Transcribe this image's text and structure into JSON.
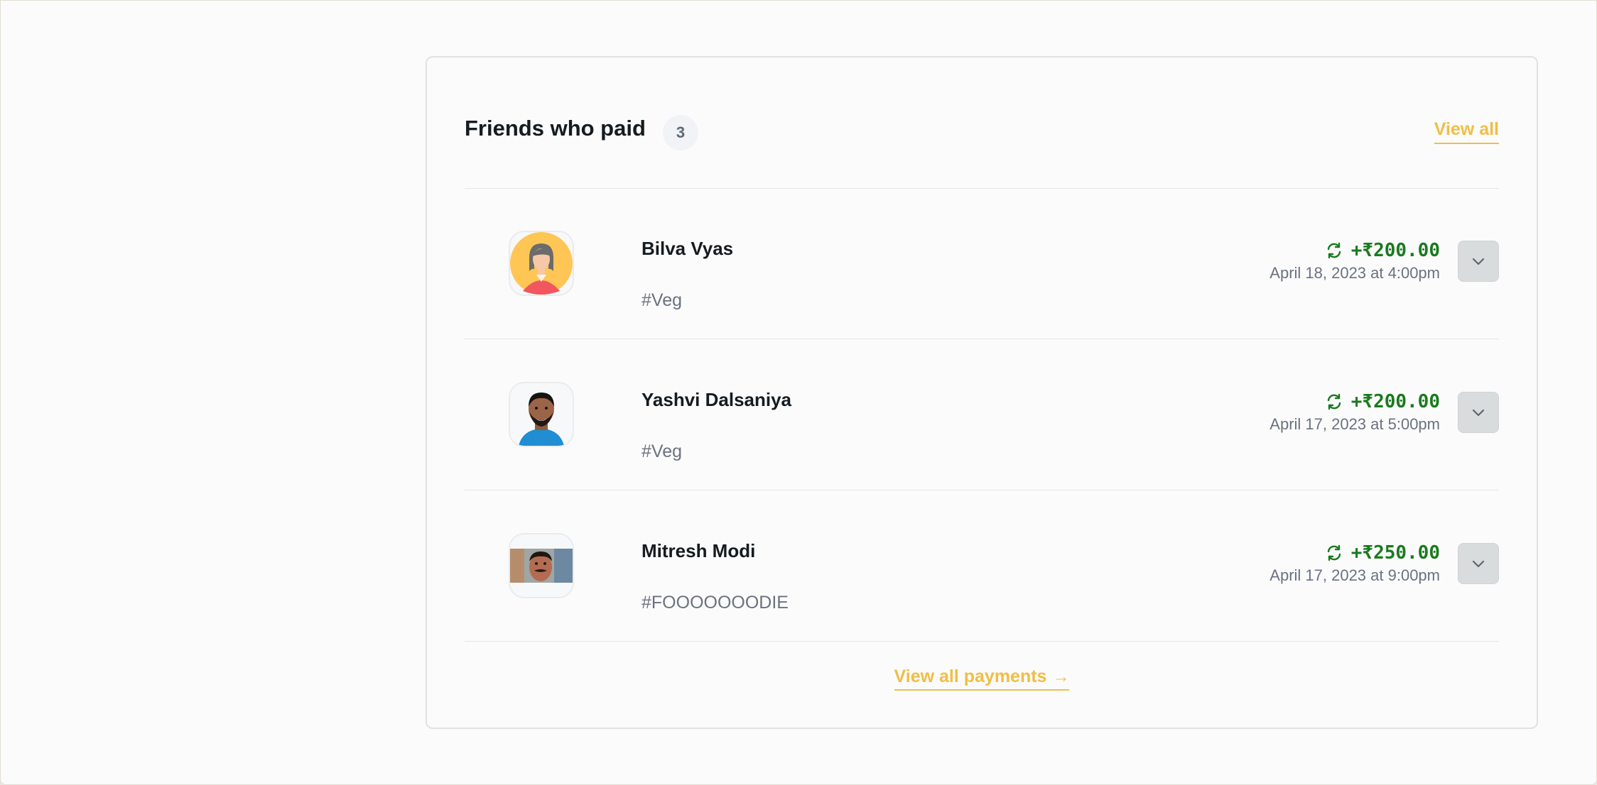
{
  "friends_paid": {
    "title": "Friends who paid",
    "count": "3",
    "view_all_label": "View all",
    "footer_link_label": "View all payments",
    "payments": [
      {
        "name": "Bilva Vyas",
        "tag": "#Veg",
        "amount": "+₹200.00",
        "date": "April 18, 2023 at 4:00pm"
      },
      {
        "name": "Yashvi Dalsaniya",
        "tag": "#Veg",
        "amount": "+₹200.00",
        "date": "April 17, 2023 at 5:00pm"
      },
      {
        "name": "Mitresh Modi",
        "tag": "#FOOOOOOODIE",
        "amount": "+₹250.00",
        "date": "April 17, 2023 at 9:00pm"
      }
    ]
  },
  "colors": {
    "accent": "#f0be45",
    "positive": "#1a7a1e",
    "muted": "#6b7280",
    "heading": "#151b1f"
  },
  "icons": {
    "payment_status": "refresh-icon",
    "expand": "chevron-down-icon",
    "footer_arrow": "arrow-right-icon"
  }
}
